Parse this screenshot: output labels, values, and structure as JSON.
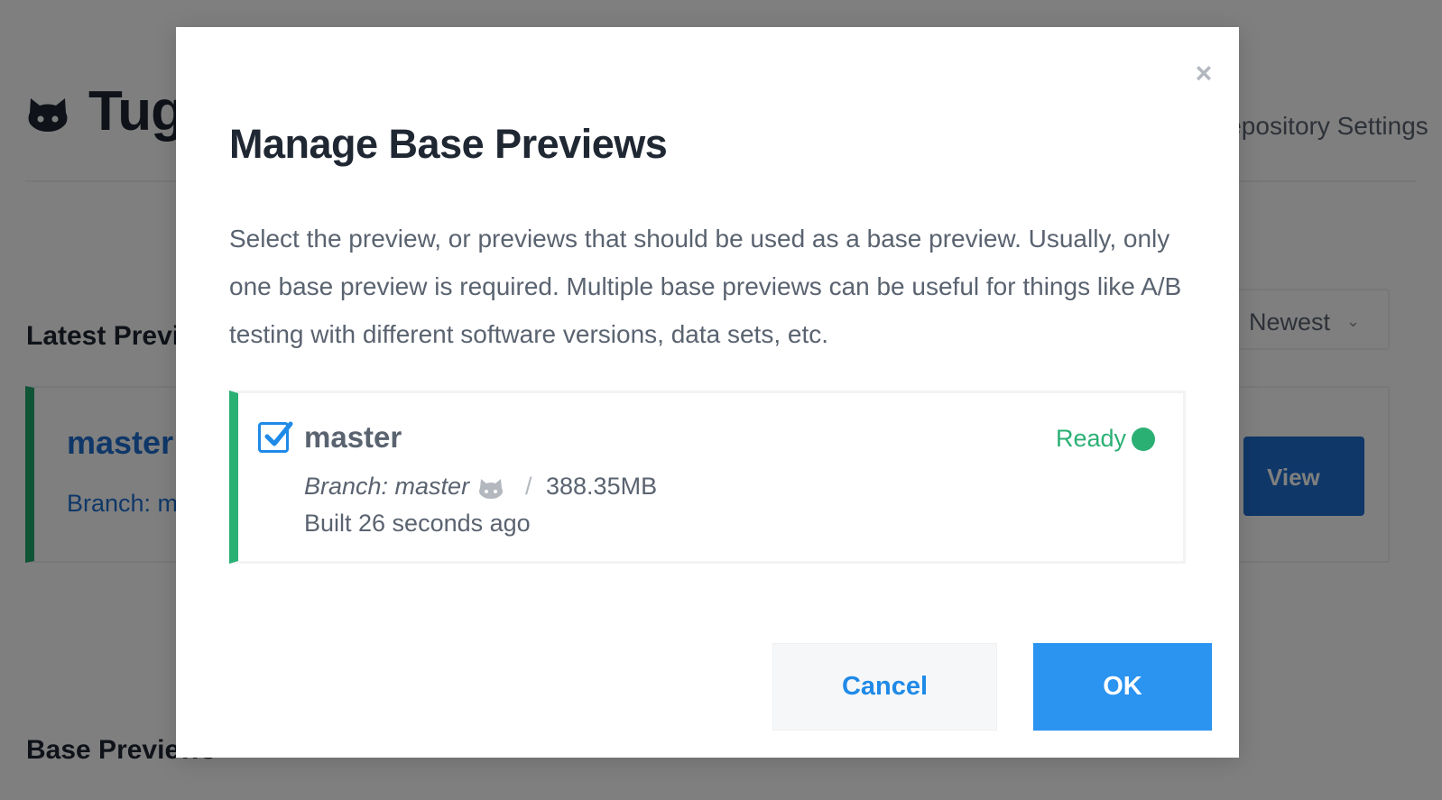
{
  "background": {
    "app_title": "Tugboat",
    "settings_link": "Repository Settings",
    "latest_section_title": "Latest Previews",
    "sort_select": {
      "selected": "Newest"
    },
    "preview_card": {
      "name": "master",
      "branch_text": "Branch: master",
      "view_button_label": "View"
    },
    "base_section_title": "Base Previews"
  },
  "modal": {
    "close_symbol": "×",
    "title": "Manage Base Previews",
    "description": "Select the preview, or previews that should be used as a base preview. Usually, only one base preview is required. Multiple base previews can be useful for things like A/B testing with different software versions, data sets, etc.",
    "previews": [
      {
        "checked": true,
        "name": "master",
        "status": "Ready",
        "status_color": "#2bb074",
        "branch": "Branch: master",
        "separator": "/",
        "size": "388.35MB",
        "built": "Built 26 seconds ago"
      }
    ],
    "cancel_label": "Cancel",
    "ok_label": "OK"
  },
  "colors": {
    "accent": "#2b93f0",
    "success": "#2bb074",
    "link": "#1f6fd1"
  },
  "icons": {
    "logo": "octocat-icon",
    "source": "github-icon",
    "checkbox": "check-icon",
    "close": "close-icon",
    "sort": "chevron-down-icon",
    "view": "arrow-icon"
  }
}
